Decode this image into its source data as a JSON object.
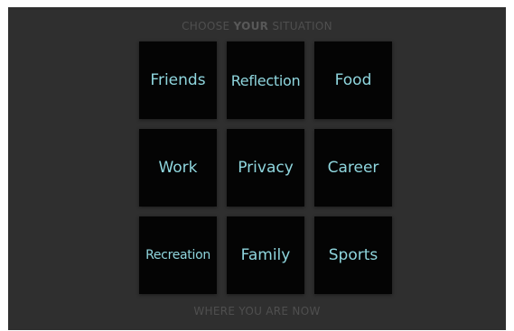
{
  "header": {
    "prefix": "CHOOSE ",
    "emphasis": "YOUR",
    "suffix": " SITUATION"
  },
  "situations": [
    {
      "label": "Friends"
    },
    {
      "label": "Reflection"
    },
    {
      "label": "Food"
    },
    {
      "label": "Work"
    },
    {
      "label": "Privacy"
    },
    {
      "label": "Career"
    },
    {
      "label": "Recreation"
    },
    {
      "label": "Family"
    },
    {
      "label": "Sports"
    }
  ],
  "footer": {
    "text": "WHERE YOU ARE NOW"
  },
  "colors": {
    "panel": "#2f2f2f",
    "tile": "#040404",
    "label": "#8fd6de",
    "heading": "#4f4f4f"
  }
}
